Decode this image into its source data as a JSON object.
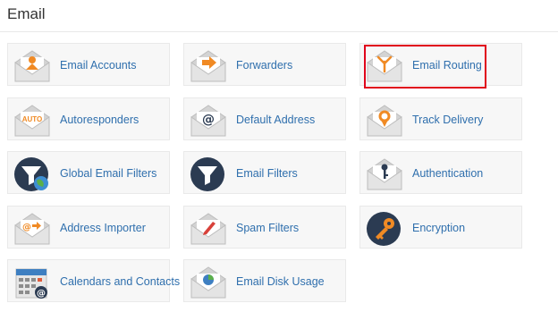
{
  "section": {
    "title": "Email"
  },
  "tiles": [
    {
      "label": "Email Accounts",
      "icon": "envelope-person-icon"
    },
    {
      "label": "Forwarders",
      "icon": "envelope-arrow-icon"
    },
    {
      "label": "Email Routing",
      "icon": "envelope-routing-icon"
    },
    {
      "label": "Autoresponders",
      "icon": "envelope-auto-icon",
      "icon_text": "AUTO"
    },
    {
      "label": "Default Address",
      "icon": "envelope-at-icon"
    },
    {
      "label": "Track Delivery",
      "icon": "envelope-location-pin-icon"
    },
    {
      "label": "Global Email Filters",
      "icon": "globe-funnel-icon"
    },
    {
      "label": "Email Filters",
      "icon": "funnel-icon"
    },
    {
      "label": "Authentication",
      "icon": "envelope-key-icon"
    },
    {
      "label": "Address Importer",
      "icon": "envelope-at-arrow-icon"
    },
    {
      "label": "Spam Filters",
      "icon": "envelope-pen-icon"
    },
    {
      "label": "Encryption",
      "icon": "key-circle-icon"
    },
    {
      "label": "Calendars and Contacts",
      "icon": "calendar-at-icon"
    },
    {
      "label": "Email Disk Usage",
      "icon": "envelope-pie-chart-icon"
    }
  ],
  "highlighted_tile": "Email Routing",
  "colors": {
    "link": "#2f6fad",
    "accent_orange": "#f08a24",
    "icon_navy": "#2b3b52",
    "envelope_gray": "#c9c9c9",
    "highlight_red": "#e0001b"
  }
}
